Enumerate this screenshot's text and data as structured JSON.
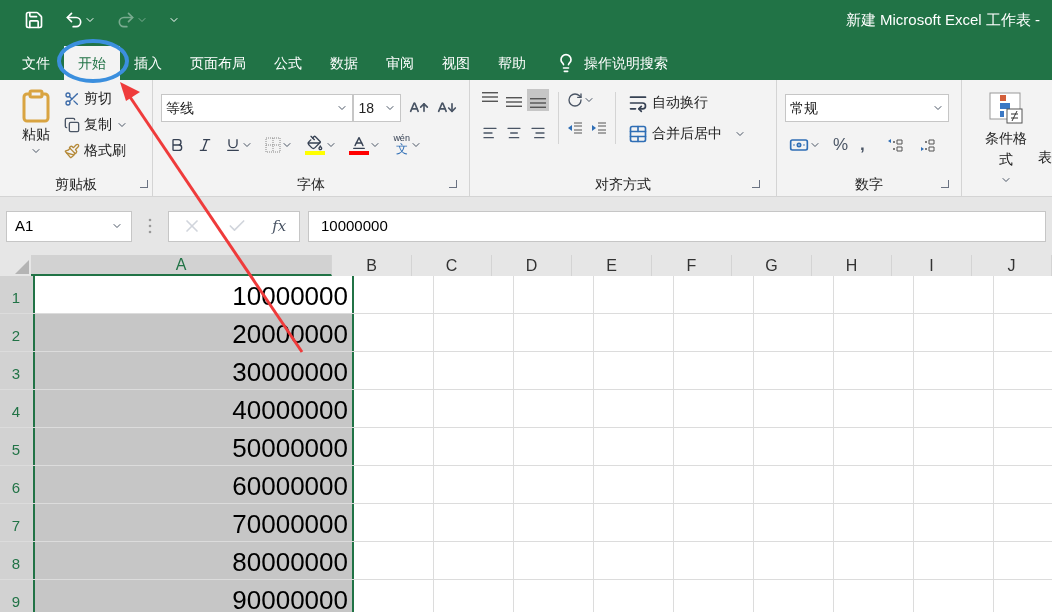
{
  "window": {
    "title": "新建 Microsoft Excel 工作表 -"
  },
  "tabs": [
    {
      "label": "文件",
      "selected": false
    },
    {
      "label": "开始",
      "selected": true
    },
    {
      "label": "插入",
      "selected": false
    },
    {
      "label": "页面布局",
      "selected": false
    },
    {
      "label": "公式",
      "selected": false
    },
    {
      "label": "数据",
      "selected": false
    },
    {
      "label": "审阅",
      "selected": false
    },
    {
      "label": "视图",
      "selected": false
    },
    {
      "label": "帮助",
      "selected": false
    }
  ],
  "tell_me": "操作说明搜索",
  "clipboard": {
    "paste": "粘贴",
    "cut": "剪切",
    "copy": "复制",
    "format_painter": "格式刷",
    "group": "剪贴板"
  },
  "font": {
    "name": "等线",
    "size": "18",
    "phonetic_top": "wén",
    "phonetic_bottom": "文",
    "group": "字体"
  },
  "alignment": {
    "wrap": "自动换行",
    "merge": "合并后居中",
    "group": "对齐方式"
  },
  "number": {
    "format": "常规",
    "percent": "%",
    "comma": ",",
    "group": "数字"
  },
  "styles": {
    "conditional": "条件格式",
    "cut_label": "表"
  },
  "formula_bar": {
    "name_box": "A1",
    "fx": "fx",
    "value": "10000000"
  },
  "columns": [
    {
      "label": "A",
      "selected": true
    },
    {
      "label": "B",
      "selected": false
    },
    {
      "label": "C",
      "selected": false
    },
    {
      "label": "D",
      "selected": false
    },
    {
      "label": "E",
      "selected": false
    },
    {
      "label": "F",
      "selected": false
    },
    {
      "label": "G",
      "selected": false
    },
    {
      "label": "H",
      "selected": false
    },
    {
      "label": "I",
      "selected": false
    },
    {
      "label": "J",
      "selected": false
    }
  ],
  "rows": [
    {
      "number": "1",
      "value": "10000000",
      "active": true
    },
    {
      "number": "2",
      "value": "20000000",
      "active": false
    },
    {
      "number": "3",
      "value": "30000000",
      "active": false
    },
    {
      "number": "4",
      "value": "40000000",
      "active": false
    },
    {
      "number": "5",
      "value": "50000000",
      "active": false
    },
    {
      "number": "6",
      "value": "60000000",
      "active": false
    },
    {
      "number": "7",
      "value": "70000000",
      "active": false
    },
    {
      "number": "8",
      "value": "80000000",
      "active": false
    },
    {
      "number": "9",
      "value": "90000000",
      "active": false
    }
  ]
}
